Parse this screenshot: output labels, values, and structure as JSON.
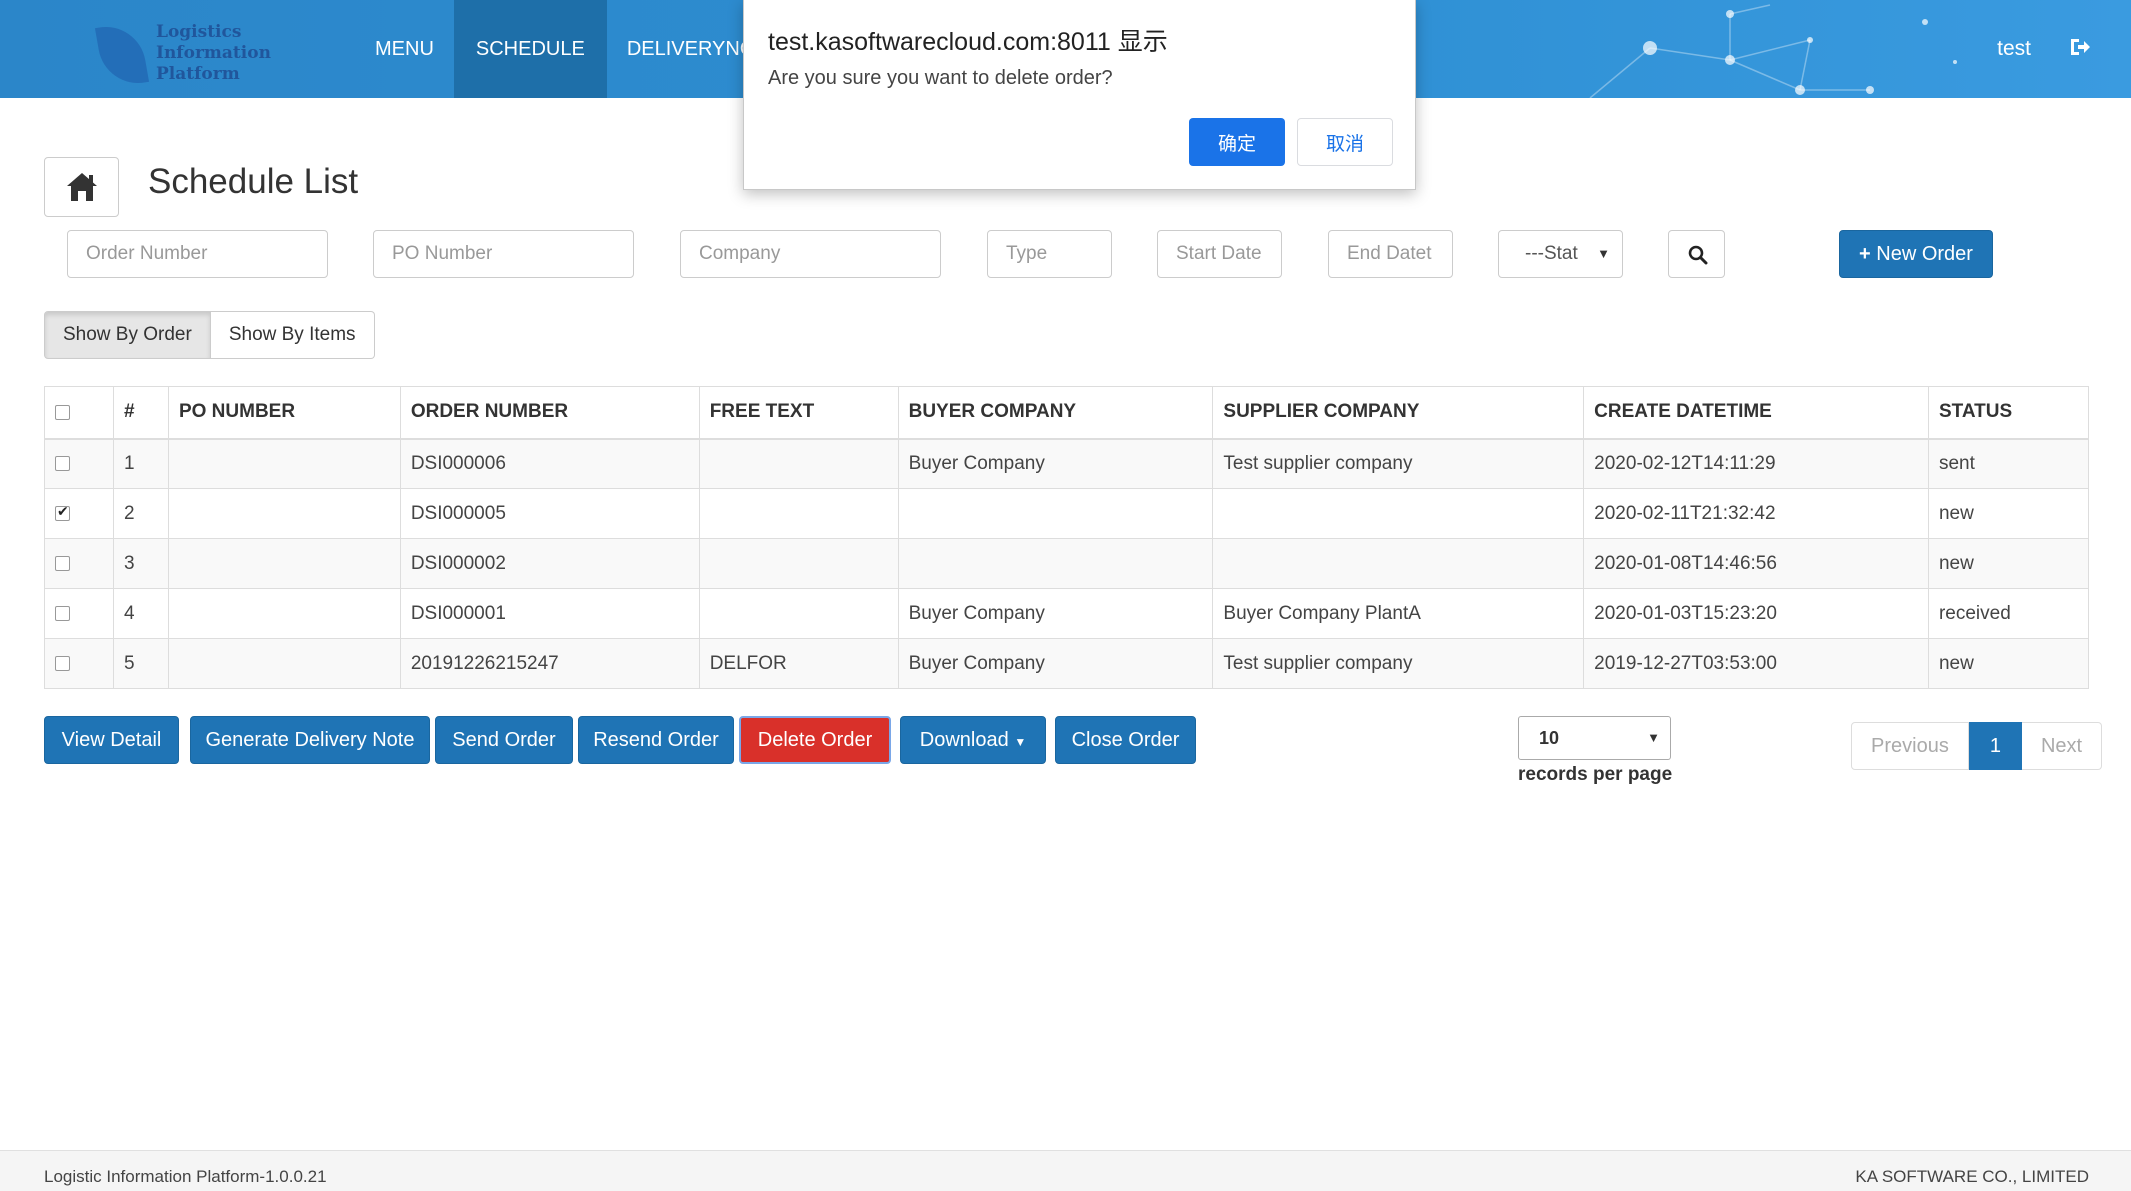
{
  "header": {
    "logo_lines": [
      "Logistics",
      "Information",
      "Platform"
    ],
    "nav": [
      "MENU",
      "SCHEDULE",
      "DELIVERYNOT"
    ],
    "active_nav": "SCHEDULE",
    "user": "test",
    "logout_icon": "sign-out-icon"
  },
  "dialog": {
    "title": "test.kasoftwarecloud.com:8011 显示",
    "message": "Are you sure you want to delete order?",
    "ok_label": "确定",
    "cancel_label": "取消"
  },
  "page": {
    "title": "Schedule List",
    "home_icon": "home-icon"
  },
  "filters": {
    "order_number_placeholder": "Order Number",
    "po_number_placeholder": "PO Number",
    "company_placeholder": "Company",
    "type_placeholder": "Type",
    "start_date_placeholder": "Start Date",
    "end_date_placeholder": "End Datet",
    "status_value": "---Stat",
    "search_icon": "search-icon",
    "new_order_label": "New Order"
  },
  "view_toggle": {
    "by_order": "Show By Order",
    "by_items": "Show By Items"
  },
  "table": {
    "columns": [
      "#",
      "PO NUMBER",
      "ORDER NUMBER",
      "FREE TEXT",
      "BUYER COMPANY",
      "SUPPLIER COMPANY",
      "CREATE DATETIME",
      "STATUS"
    ],
    "rows": [
      {
        "checked": false,
        "num": "1",
        "po": "",
        "order": "DSI000006",
        "free": "",
        "buyer": "Buyer Company",
        "supplier": "Test supplier company",
        "created": "2020-02-12T14:11:29",
        "status": "sent"
      },
      {
        "checked": true,
        "num": "2",
        "po": "",
        "order": "DSI000005",
        "free": "",
        "buyer": "",
        "supplier": "",
        "created": "2020-02-11T21:32:42",
        "status": "new"
      },
      {
        "checked": false,
        "num": "3",
        "po": "",
        "order": "DSI000002",
        "free": "",
        "buyer": "",
        "supplier": "",
        "created": "2020-01-08T14:46:56",
        "status": "new"
      },
      {
        "checked": false,
        "num": "4",
        "po": "",
        "order": "DSI000001",
        "free": "",
        "buyer": "Buyer Company",
        "supplier": "Buyer Company PlantA",
        "created": "2020-01-03T15:23:20",
        "status": "received"
      },
      {
        "checked": false,
        "num": "5",
        "po": "",
        "order": "20191226215247",
        "free": "DELFOR",
        "buyer": "Buyer Company",
        "supplier": "Test supplier company",
        "created": "2019-12-27T03:53:00",
        "status": "new"
      }
    ]
  },
  "actions": {
    "view_detail": "View Detail",
    "generate_delivery_note": "Generate Delivery Note",
    "send_order": "Send Order",
    "resend_order": "Resend Order",
    "delete_order": "Delete Order",
    "download": "Download",
    "close_order": "Close Order"
  },
  "pagination": {
    "per_page_value": "10",
    "per_page_label": "records per page",
    "previous": "Previous",
    "current": "1",
    "next": "Next"
  },
  "footer": {
    "left": "Logistic Information Platform-1.0.0.21",
    "right": "KA SOFTWARE CO., LIMITED"
  },
  "colors": {
    "header": "#2e8fd3",
    "primary": "#1f74b5",
    "danger": "#d9302a",
    "dialog_button": "#1a73e8"
  }
}
